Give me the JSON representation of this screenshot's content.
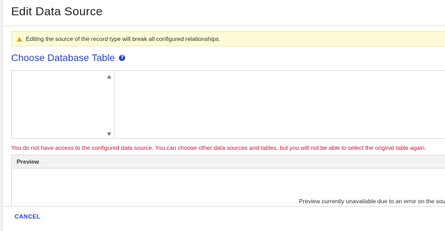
{
  "dialog": {
    "title": "Edit Data Source"
  },
  "banner": {
    "message": "Editing the source of the record type will break all configured relationships.",
    "icon": "warning-icon",
    "icon_color": "#e9a90c",
    "background_color": "#fdfbd8"
  },
  "section": {
    "heading": "Choose Database Table",
    "help_icon": "?"
  },
  "error": {
    "message": "You do not have access to the configured data source. You can choose other data sources and tables, but you will not be able to select the original table again.",
    "color": "#c4183c"
  },
  "preview": {
    "header": "Preview",
    "message": "Preview currently unavailable due to an error on the source"
  },
  "footer": {
    "cancel_label": "CANCEL"
  },
  "colors": {
    "accent": "#2b45c5"
  }
}
